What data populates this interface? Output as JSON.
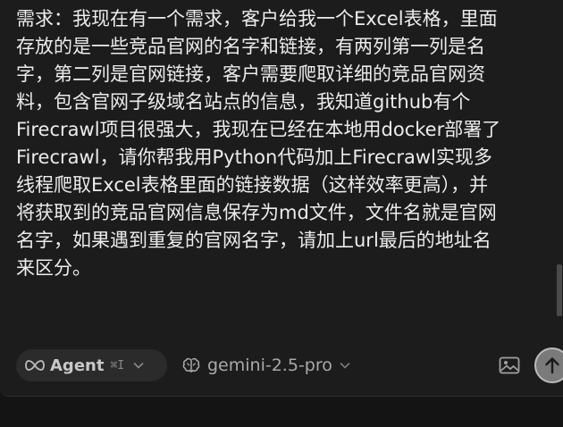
{
  "prompt": {
    "text": "需求：我现在有一个需求，客户给我一个Excel表格，里面\n存放的是一些竞品官网的名字和链接，有两列第一列是名\n字，第二列是官网链接，客户需要爬取详细的竞品官网资\n料，包含官网子级域名站点的信息，我知道github有个\nFirecrawl项目很强大，我现在已经在本地用docker部署了\nFirecrawl，请你帮我用Python代码加上Firecrawl实现多\n线程爬取Excel表格里面的链接数据（这样效率更高），并\n将获取到的竞品官网信息保存为md文件，文件名就是官网\n名字，如果遇到重复的官网名字，请加上url最后的地址名\n来区分。"
  },
  "toolbar": {
    "mode_label": "Agent",
    "mode_shortcut": "⌘I",
    "model_label": "gemini-2.5-pro"
  },
  "icons": {
    "mode": "infinity-icon",
    "mode_dropdown": "chevron-down-icon",
    "model": "brain-icon",
    "model_dropdown": "chevron-down-icon",
    "attach": "image-icon",
    "send": "arrow-up-icon"
  },
  "colors": {
    "panel_background": "#1c1c1c",
    "page_background": "#141414",
    "text": "#ececec",
    "pill_background": "#2b2b2b",
    "send_button": "#7a7a7a"
  }
}
